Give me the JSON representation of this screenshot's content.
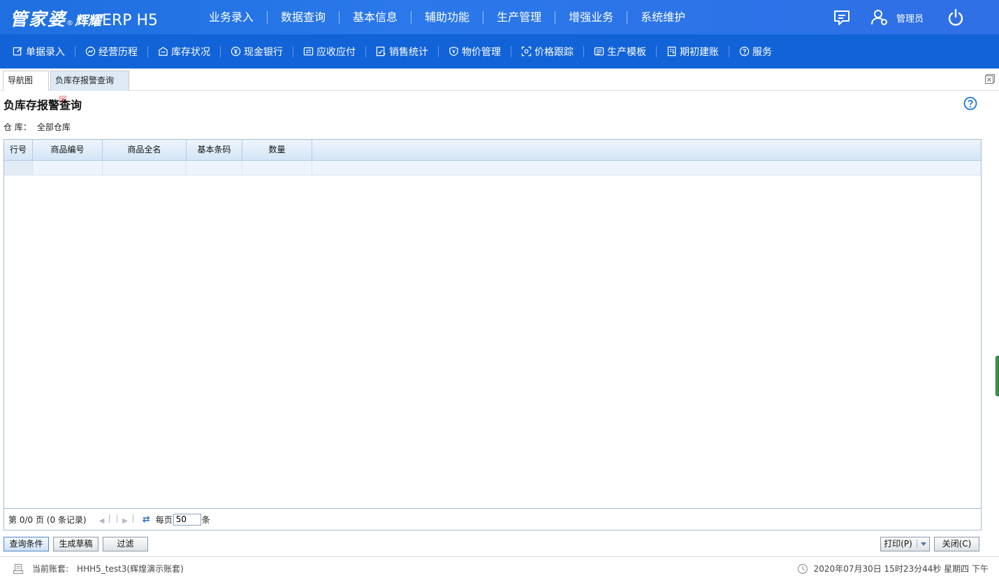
{
  "header": {
    "logo_main": "管家婆",
    "logo_reg": "®",
    "logo_sub": "辉耀",
    "logo_product": "ERP H5",
    "nav": [
      "业务录入",
      "数据查询",
      "基本信息",
      "辅助功能",
      "生产管理",
      "增强业务",
      "系统维护"
    ],
    "username": "管理员"
  },
  "toolbar": {
    "items": [
      {
        "label": "单据录入",
        "icon": "edit-icon"
      },
      {
        "label": "经营历程",
        "icon": "chart-circle-icon"
      },
      {
        "label": "库存状况",
        "icon": "warehouse-icon"
      },
      {
        "label": "现金银行",
        "icon": "yen-icon"
      },
      {
        "label": "应收应付",
        "icon": "transfer-icon"
      },
      {
        "label": "销售统计",
        "icon": "stats-check-icon"
      },
      {
        "label": "物价管理",
        "icon": "shield-price-icon"
      },
      {
        "label": "价格跟踪",
        "icon": "focus-icon"
      },
      {
        "label": "生产模板",
        "icon": "template-icon"
      },
      {
        "label": "期初建账",
        "icon": "ledger-icon"
      },
      {
        "label": "服务",
        "icon": "help-circle-icon"
      }
    ]
  },
  "tabs": [
    {
      "label": "导航图",
      "active": false
    },
    {
      "label": "负库存报警查询",
      "active": true
    }
  ],
  "page": {
    "title": "负库存报警查询",
    "filter_label": "仓 库：",
    "filter_value": "全部仓库"
  },
  "grid": {
    "columns": [
      "行号",
      "商品编号",
      "商品全名",
      "基本条码",
      "数量"
    ],
    "rows": []
  },
  "pager": {
    "status": "第 0/0 页 (0 条记录)",
    "per_page_label": "每页",
    "per_page_value": "50",
    "per_page_unit": "条"
  },
  "buttons": {
    "query": "查询条件",
    "draft": "生成草稿",
    "filter": "过滤",
    "print": "打印(P)",
    "close": "关闭(C)"
  },
  "status": {
    "account_label": "当前账套:",
    "account_value": "HHH5_test3(辉煌演示账套)",
    "datetime": "2020年07月30日 15时23分44秒 星期四 下午"
  },
  "colors": {
    "topbar": "#2a78ea",
    "toolbar": "#1263d8",
    "grid_header": "#d4e5f7"
  }
}
